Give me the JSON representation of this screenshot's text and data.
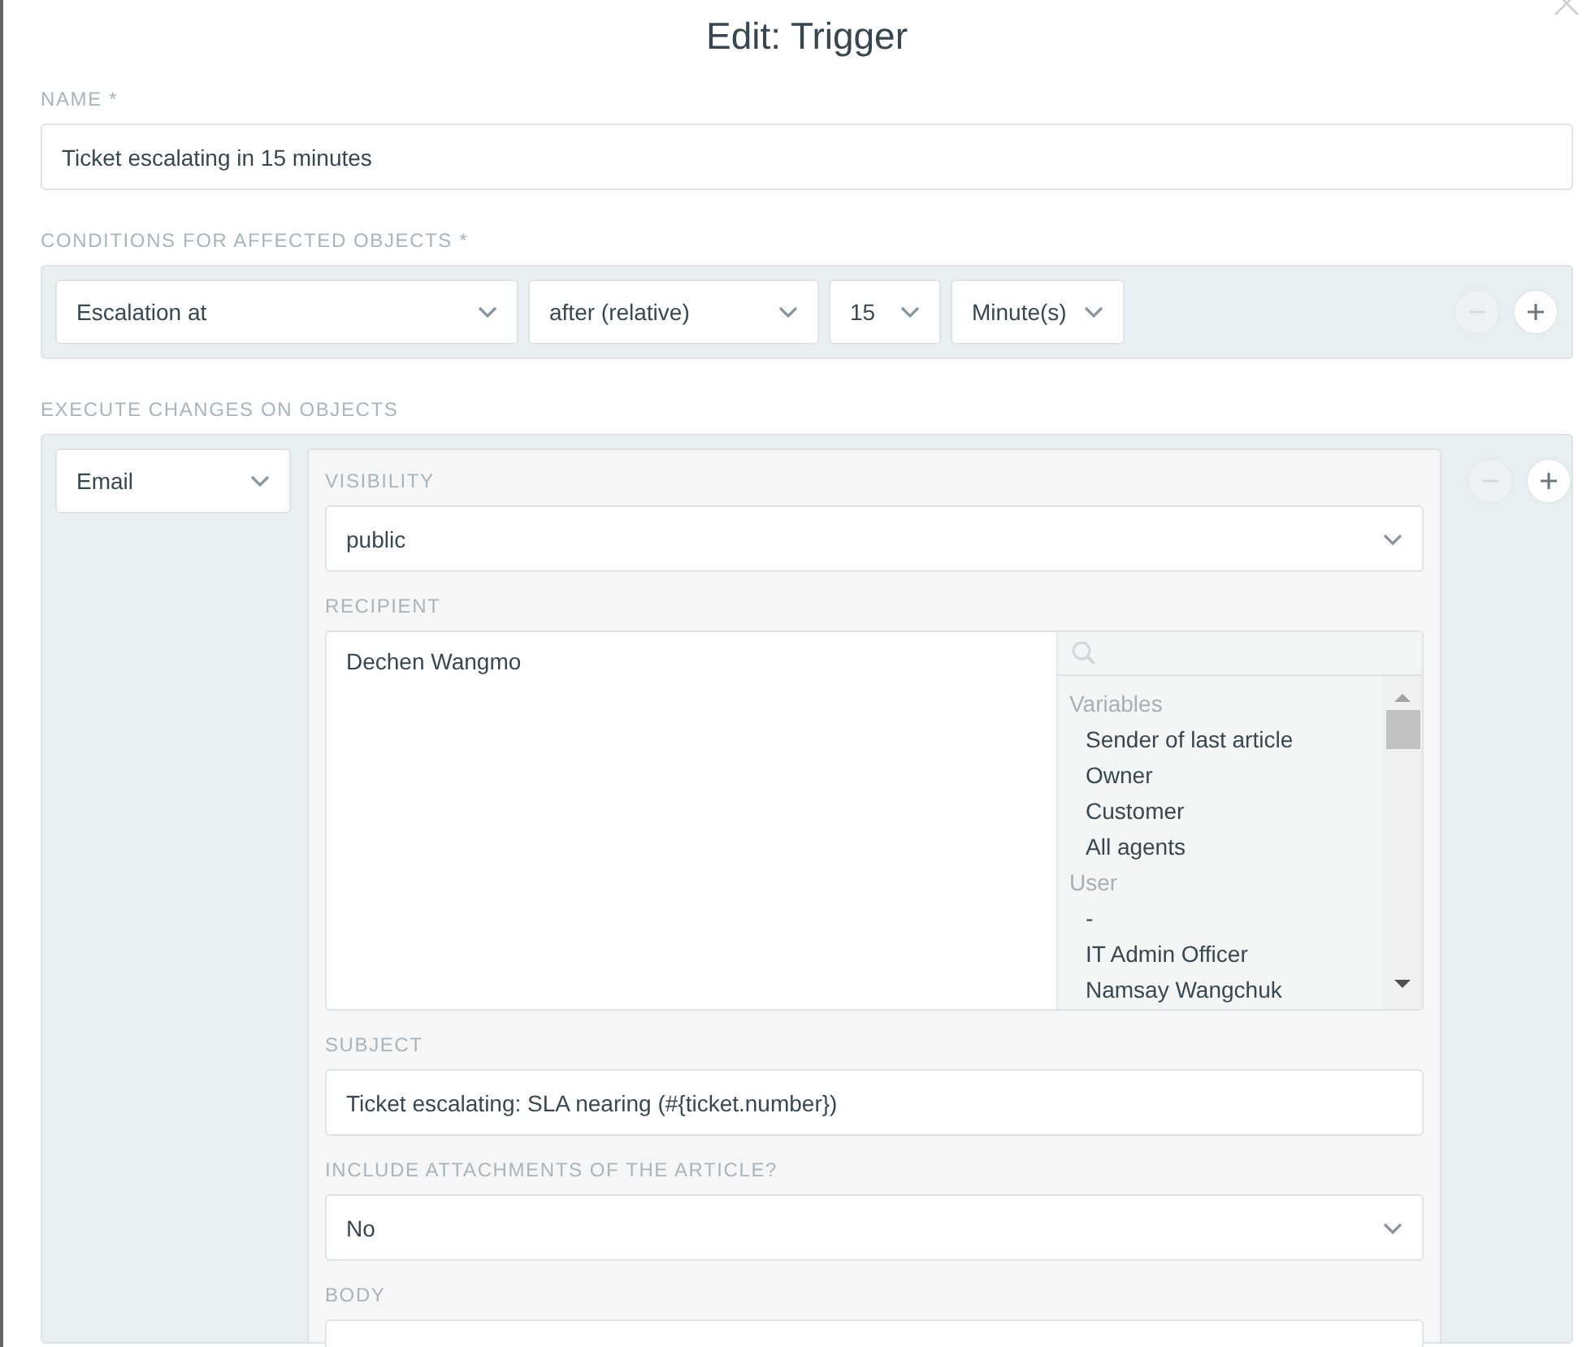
{
  "dialog": {
    "title": "Edit: Trigger"
  },
  "name": {
    "label": "NAME *",
    "value": "Ticket escalating in 15 minutes"
  },
  "conditions": {
    "label": "CONDITIONS FOR AFFECTED OBJECTS *",
    "selects": [
      {
        "value": "Escalation at"
      },
      {
        "value": "after (relative)"
      },
      {
        "value": "15"
      },
      {
        "value": "Minute(s)"
      }
    ],
    "buttons": [
      {
        "kind": "remove",
        "disabled": true
      },
      {
        "kind": "add",
        "disabled": false
      }
    ]
  },
  "actions": {
    "label": "EXECUTE CHANGES ON OBJECTS",
    "type_select": "Email",
    "buttons": [
      {
        "kind": "remove",
        "disabled": true
      },
      {
        "kind": "add",
        "disabled": false
      }
    ],
    "fields": [
      {
        "kind": "select",
        "label": "VISIBILITY",
        "value": "public"
      },
      {
        "kind": "recipient",
        "label": "RECIPIENT",
        "value": "Dechen Wangmo",
        "options": [
          {
            "kind": "group",
            "text": "Variables"
          },
          {
            "kind": "option",
            "text": "Sender of last article"
          },
          {
            "kind": "option",
            "text": "Owner"
          },
          {
            "kind": "option",
            "text": "Customer"
          },
          {
            "kind": "option",
            "text": "All agents"
          },
          {
            "kind": "group",
            "text": "User"
          },
          {
            "kind": "option",
            "text": "-"
          },
          {
            "kind": "option",
            "text": "IT Admin Officer"
          },
          {
            "kind": "option",
            "text": "Namsay Wangchuk"
          }
        ]
      },
      {
        "kind": "input",
        "label": "SUBJECT",
        "value": "Ticket escalating: SLA nearing (#{ticket.number})"
      },
      {
        "kind": "select",
        "label": "INCLUDE ATTACHMENTS OF THE ARTICLE?",
        "value": "No"
      },
      {
        "kind": "body",
        "label": "BODY"
      }
    ]
  }
}
